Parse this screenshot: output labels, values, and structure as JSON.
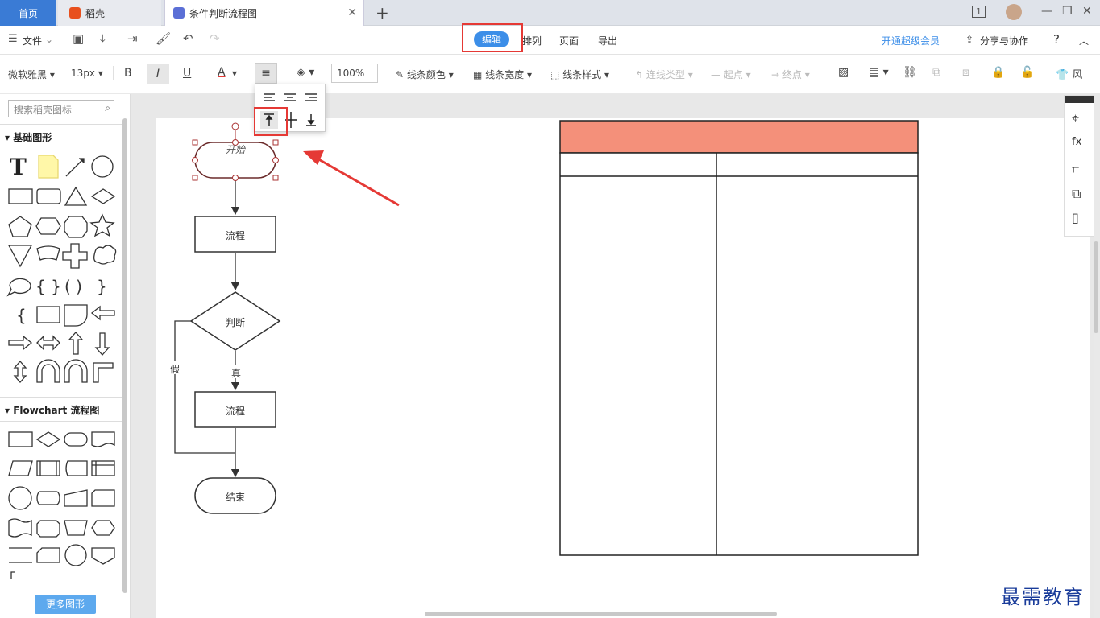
{
  "tabs": {
    "home": "首页",
    "daoke": "稻壳",
    "doc": "条件判断流程图"
  },
  "window": {
    "badge": "1"
  },
  "menubar": {
    "file": "文件",
    "edit": "编辑",
    "arrange": "排列",
    "page": "页面",
    "export": "导出",
    "vip": "开通超级会员",
    "share": "分享与协作",
    "help": "?"
  },
  "toolbar": {
    "font": "微软雅黑",
    "size": "13px",
    "bold": "B",
    "italic": "I",
    "underline": "U",
    "fontcolor": "A",
    "zoom": "100%",
    "line_color": "线条颜色",
    "line_width": "线条宽度",
    "line_style": "线条样式",
    "conn_type": "连线类型",
    "start": "起点",
    "end": "终点",
    "more": "风"
  },
  "sidebar": {
    "search_placeholder": "搜索稻壳图标",
    "basic_title": "基础图形",
    "flow_title": "Flowchart 流程图",
    "more_button": "更多图形"
  },
  "flowchart": {
    "start": "开始",
    "process1": "流程",
    "decision": "判断",
    "true_label": "真",
    "false_label": "假",
    "process2": "流程",
    "end": "结束"
  },
  "table": {
    "header_color": "#f4907a"
  },
  "watermark": "最需教育",
  "colors": {
    "accent": "#3c8ee8",
    "highlight": "#e53935",
    "home_tab": "#3a7bd5"
  }
}
